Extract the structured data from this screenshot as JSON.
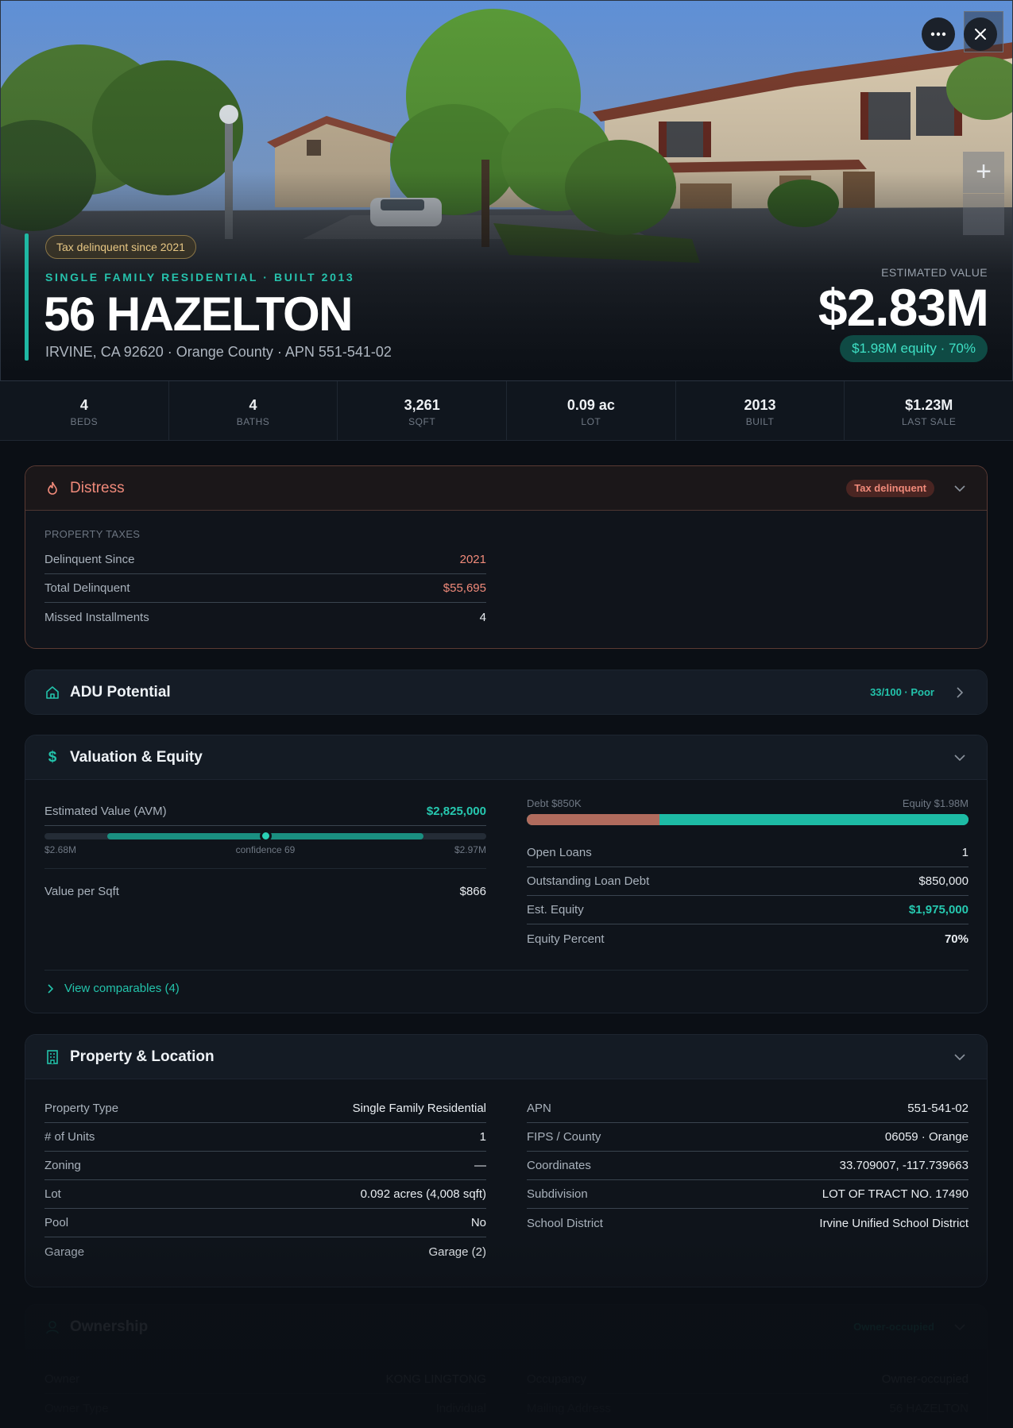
{
  "hero": {
    "tax_pill": "Tax delinquent since 2021",
    "type_line": "SINGLE FAMILY RESIDENTIAL · BUILT 2013",
    "title": "56 HAZELTON",
    "subtitle": "IRVINE, CA 92620 · Orange County · APN 551-541-02",
    "est_label": "ESTIMATED VALUE",
    "est_value": "$2.83M",
    "equity_pill": "$1.98M equity · 70%",
    "more_icon": "ellipsis-icon",
    "close_icon": "close-icon",
    "zoom_icon": "plus-icon"
  },
  "stats": [
    {
      "value": "4",
      "label": "BEDS"
    },
    {
      "value": "4",
      "label": "BATHS"
    },
    {
      "value": "3,261",
      "label": "SQFT"
    },
    {
      "value": "0.09 ac",
      "label": "LOT"
    },
    {
      "value": "2013",
      "label": "BUILT"
    },
    {
      "value": "$1.23M",
      "label": "LAST SALE"
    }
  ],
  "distress": {
    "title": "Distress",
    "badge": "Tax delinquent",
    "section": "PROPERTY TAXES",
    "rows": [
      {
        "k": "Delinquent Since",
        "v": "2021"
      },
      {
        "k": "Total Delinquent",
        "v": "$55,695"
      },
      {
        "k": "Missed Installments",
        "v": "4"
      }
    ]
  },
  "adu": {
    "title": "ADU Potential",
    "badge": "33/100 · Poor"
  },
  "valuation": {
    "title": "Valuation & Equity",
    "avm_label": "Estimated Value (AVM)",
    "avm_value": "$2,825,000",
    "range_low": "$2.68M",
    "confidence": "confidence 69",
    "range_high": "$2.97M",
    "range_low_num": 2.68,
    "range_high_num": 2.97,
    "avm_num": 2.825,
    "vps_label": "Value per Sqft",
    "vps_value": "$866",
    "debt_label": "Debt $850K",
    "equity_label": "Equity $1.98M",
    "debt_fraction": 0.3,
    "rows": [
      {
        "k": "Open Loans",
        "v": "1"
      },
      {
        "k": "Outstanding Loan Debt",
        "v": "$850,000"
      },
      {
        "k": "Est. Equity",
        "v": "$1,975,000"
      },
      {
        "k": "Equity Percent",
        "v": "70%"
      }
    ],
    "comps_link": "View comparables (4)"
  },
  "property": {
    "title": "Property & Location",
    "left": [
      {
        "k": "Property Type",
        "v": "Single Family Residential"
      },
      {
        "k": "# of Units",
        "v": "1"
      },
      {
        "k": "Zoning",
        "v": "—"
      },
      {
        "k": "Lot",
        "v": "0.092 acres (4,008 sqft)"
      },
      {
        "k": "Pool",
        "v": "No"
      },
      {
        "k": "Garage",
        "v": "Garage (2)"
      }
    ],
    "right": [
      {
        "k": "APN",
        "v": "551-541-02"
      },
      {
        "k": "FIPS / County",
        "v": "06059 · Orange"
      },
      {
        "k": "Coordinates",
        "v": "33.709007, -117.739663"
      },
      {
        "k": "Subdivision",
        "v": "LOT OF TRACT NO. 17490"
      },
      {
        "k": "School District",
        "v": "Irvine Unified School District"
      }
    ]
  },
  "ownership": {
    "title": "Ownership",
    "badge": "Owner-occupied",
    "left": [
      {
        "k": "Owner",
        "v": "KONG LINGTONG"
      },
      {
        "k": "Owner Type",
        "v": "Individual"
      }
    ],
    "right": [
      {
        "k": "Occupancy",
        "v": "Owner-occupied"
      },
      {
        "k": "Mailing Address",
        "v": "56 HAZELTON"
      }
    ]
  },
  "colors": {
    "accent": "#1fb8a3",
    "danger": "#f08a7a",
    "warning": "#e7c784"
  }
}
